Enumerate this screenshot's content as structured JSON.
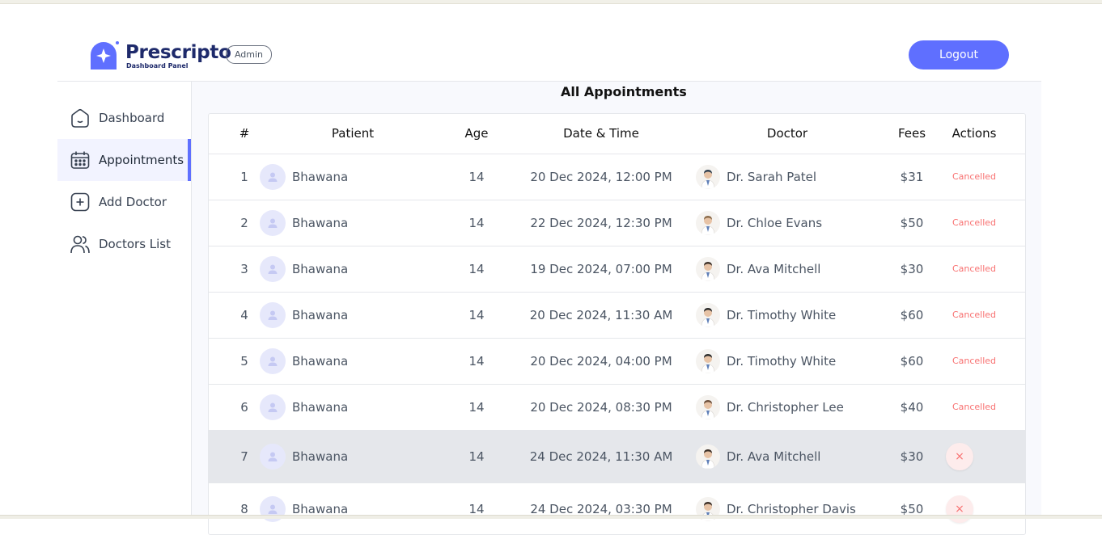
{
  "navbar": {
    "logo_text": "Prescripto",
    "logo_subtext": "Dashboard Panel",
    "role_badge": "Admin",
    "logout_label": "Logout"
  },
  "sidebar": {
    "items": [
      {
        "label": "Dashboard",
        "icon": "home-icon",
        "active": false
      },
      {
        "label": "Appointments",
        "icon": "calendar-icon",
        "active": true
      },
      {
        "label": "Add Doctor",
        "icon": "add-square-icon",
        "active": false
      },
      {
        "label": "Doctors List",
        "icon": "people-icon",
        "active": false
      }
    ]
  },
  "main": {
    "title": "All Appointments",
    "columns": [
      "#",
      "Patient",
      "Age",
      "Date & Time",
      "Doctor",
      "Fees",
      "Actions"
    ],
    "rows": [
      {
        "num": "1",
        "patient": "Bhawana",
        "age": "14",
        "datetime": "20 Dec 2024, 12:00 PM",
        "doctor": "Dr. Sarah Patel",
        "fees": "$31",
        "status": "Cancelled"
      },
      {
        "num": "2",
        "patient": "Bhawana",
        "age": "14",
        "datetime": "22 Dec 2024, 12:30 PM",
        "doctor": "Dr. Chloe Evans",
        "fees": "$50",
        "status": "Cancelled"
      },
      {
        "num": "3",
        "patient": "Bhawana",
        "age": "14",
        "datetime": "19 Dec 2024, 07:00 PM",
        "doctor": "Dr. Ava Mitchell",
        "fees": "$30",
        "status": "Cancelled"
      },
      {
        "num": "4",
        "patient": "Bhawana",
        "age": "14",
        "datetime": "20 Dec 2024, 11:30 AM",
        "doctor": "Dr. Timothy White",
        "fees": "$60",
        "status": "Cancelled"
      },
      {
        "num": "5",
        "patient": "Bhawana",
        "age": "14",
        "datetime": "20 Dec 2024, 04:00 PM",
        "doctor": "Dr. Timothy White",
        "fees": "$60",
        "status": "Cancelled"
      },
      {
        "num": "6",
        "patient": "Bhawana",
        "age": "14",
        "datetime": "20 Dec 2024, 08:30 PM",
        "doctor": "Dr. Christopher Lee",
        "fees": "$40",
        "status": "Cancelled"
      },
      {
        "num": "7",
        "patient": "Bhawana",
        "age": "14",
        "datetime": "24 Dec 2024, 11:30 AM",
        "doctor": "Dr. Ava Mitchell",
        "fees": "$30",
        "status": ""
      },
      {
        "num": "8",
        "patient": "Bhawana",
        "age": "14",
        "datetime": "24 Dec 2024, 03:30 PM",
        "doctor": "Dr. Christopher Davis",
        "fees": "$50",
        "status": ""
      }
    ],
    "cancel_icon": "×"
  },
  "colors": {
    "accent": "#5f6fff",
    "cancelled_text": "#f87171",
    "active_bg": "#f2f3ff",
    "highlight_row": "#e5e7eb"
  }
}
